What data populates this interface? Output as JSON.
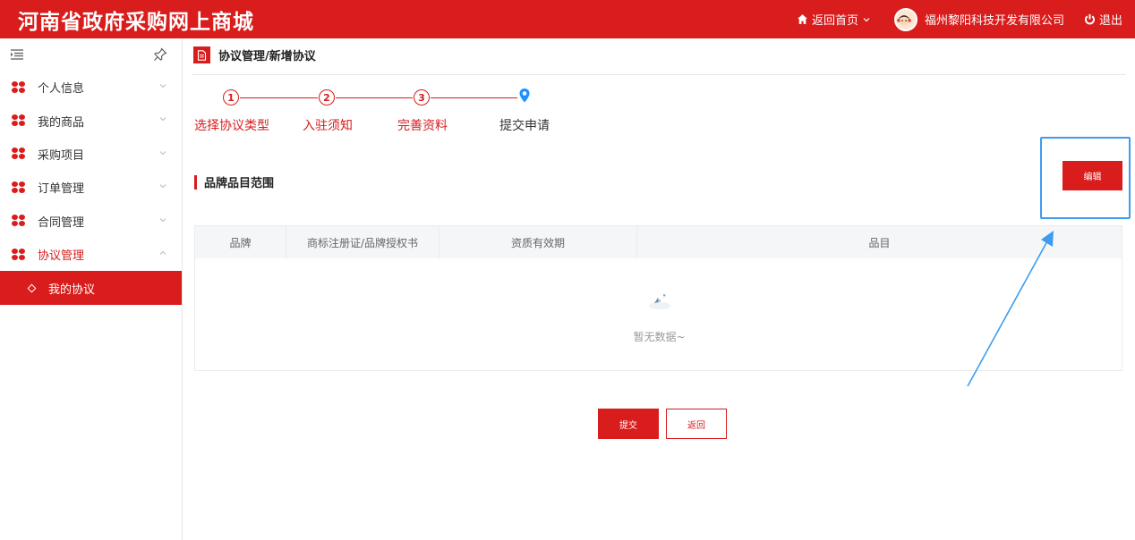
{
  "header": {
    "brand": "河南省政府采购网上商城",
    "home_link": "返回首页",
    "company": "福州黎阳科技开发有限公司",
    "logout": "退出",
    "icons": {
      "home": "home-icon",
      "dropdown": "chevron-down-icon",
      "avatar": "avatar",
      "logout": "power-icon"
    }
  },
  "sidebar": {
    "items": [
      {
        "label": "个人信息"
      },
      {
        "label": "我的商品"
      },
      {
        "label": "采购项目"
      },
      {
        "label": "订单管理"
      },
      {
        "label": "合同管理"
      },
      {
        "label": "协议管理"
      }
    ],
    "sub_items": [
      {
        "label": "我的协议"
      }
    ]
  },
  "breadcrumb": {
    "text": "协议管理/新增协议"
  },
  "steps": [
    {
      "num": "1",
      "label": "选择协议类型"
    },
    {
      "num": "2",
      "label": "入驻须知"
    },
    {
      "num": "3",
      "label": "完善资料"
    },
    {
      "num": "",
      "label": "提交申请"
    }
  ],
  "section": {
    "title": "品牌品目范围",
    "edit_label": "编辑"
  },
  "table": {
    "columns": [
      "品牌",
      "商标注册证/品牌授权书",
      "资质有效期",
      "品目"
    ],
    "empty_text": "暂无数据~"
  },
  "actions": {
    "submit": "提交",
    "back": "返回"
  },
  "colors": {
    "primary": "#d91c1c",
    "highlight": "#3d9cf0"
  }
}
